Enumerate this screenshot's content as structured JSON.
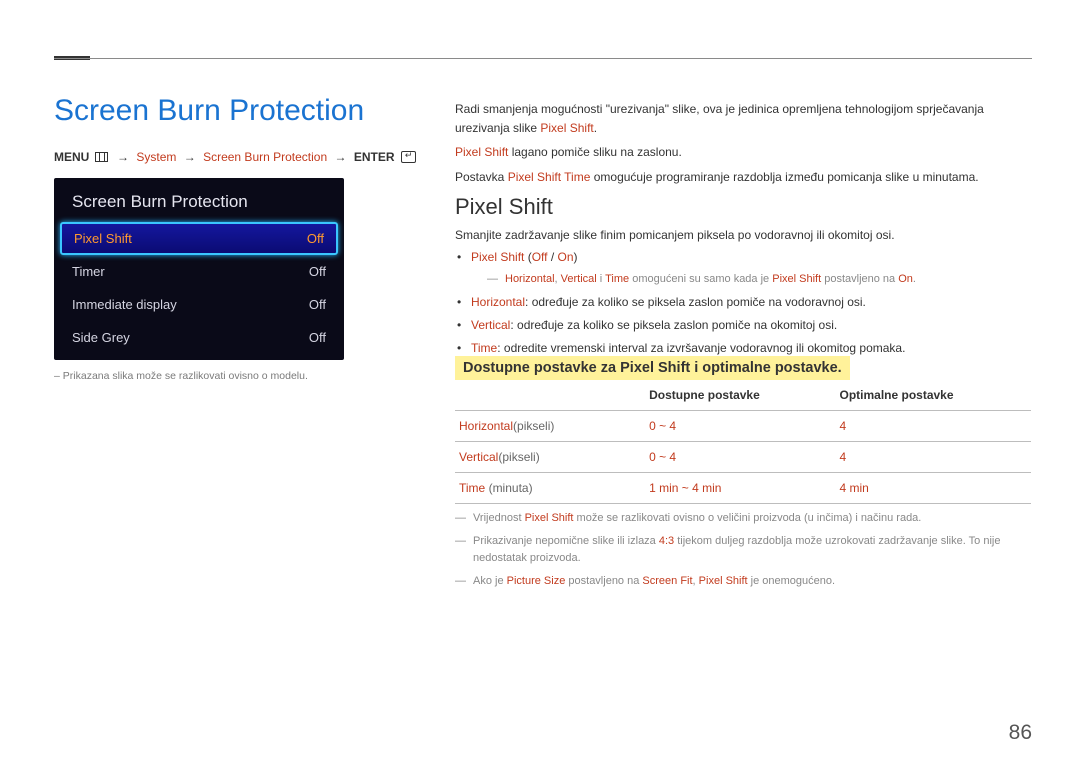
{
  "page_number": "86",
  "title": "Screen Burn Protection",
  "breadcrumb": {
    "menu": "MENU",
    "seg1": "System",
    "seg2": "Screen Burn Protection",
    "enter": "ENTER"
  },
  "panel": {
    "title": "Screen Burn Protection",
    "rows": [
      {
        "label": "Pixel Shift",
        "value": "Off",
        "selected": true
      },
      {
        "label": "Timer",
        "value": "Off",
        "selected": false
      },
      {
        "label": "Immediate display",
        "value": "Off",
        "selected": false
      },
      {
        "label": "Side Grey",
        "value": "Off",
        "selected": false
      }
    ],
    "footnote": "Prikazana slika može se razlikovati ovisno o modelu."
  },
  "intro": {
    "p1_pre": "Radi smanjenja mogućnosti \"urezivanja\" slike, ova je jedinica opremljena tehnologijom sprječavanja urezivanja slike ",
    "p1_red": "Pixel Shift",
    "p1_post": ".",
    "p2_red": "Pixel Shift",
    "p2_post": " lagano pomiče sliku na zaslonu.",
    "p3_pre": "Postavka ",
    "p3_red": "Pixel Shift Time",
    "p3_post": " omogućuje programiranje razdoblja između pomicanja slike u minutama."
  },
  "section": {
    "heading": "Pixel Shift",
    "desc": "Smanjite zadržavanje slike finim pomicanjem piksela po vodoravnoj ili okomitoj osi.",
    "bullet1_red": "Pixel Shift",
    "bullet1_mid": " (",
    "bullet1_off": "Off",
    "bullet1_sep": " / ",
    "bullet1_on": "On",
    "bullet1_end": ")",
    "note1": {
      "r1": "Horizontal",
      "c1": ", ",
      "r2": "Vertical",
      "c2": " i ",
      "r3": "Time",
      "mid": " omogućeni su samo kada je ",
      "r4": "Pixel Shift",
      "mid2": " postavljeno na ",
      "r5": "On",
      "end": "."
    },
    "bullet2_red": "Horizontal",
    "bullet2_text": ": određuje za koliko se piksela zaslon pomiče na vodoravnoj osi.",
    "bullet3_red": "Vertical",
    "bullet3_text": ": određuje za koliko se piksela zaslon pomiče na okomitoj osi.",
    "bullet4_red": "Time",
    "bullet4_text": ": odredite vremenski interval za izvršavanje vodoravnog ili okomitog pomaka."
  },
  "hl_heading": "Dostupne postavke za Pixel Shift i optimalne postavke.",
  "table": {
    "col_available": "Dostupne postavke",
    "col_optimal": "Optimalne postavke",
    "rows": [
      {
        "label_red": "Horizontal",
        "unit": "(pikseli)",
        "available": "0 ~ 4",
        "optimal": "4"
      },
      {
        "label_red": "Vertical",
        "unit": "(pikseli)",
        "available": "0 ~ 4",
        "optimal": "4"
      },
      {
        "label_red": "Time",
        "unit": " (minuta)",
        "available": "1 min ~ 4 min",
        "optimal": "4 min"
      }
    ]
  },
  "notes": {
    "n1_pre": "Vrijednost ",
    "n1_red": "Pixel Shift",
    "n1_post": " može se razlikovati ovisno o veličini proizvoda (u inčima) i načinu rada.",
    "n2_pre": "Prikazivanje nepomične slike ili izlaza ",
    "n2_red": "4:3",
    "n2_post": " tijekom duljeg razdoblja može uzrokovati zadržavanje slike. To nije nedostatak proizvoda.",
    "n3_pre": "Ako je ",
    "n3_red1": "Picture Size",
    "n3_mid1": " postavljeno na ",
    "n3_red2": "Screen Fit",
    "n3_mid2": ", ",
    "n3_red3": "Pixel Shift",
    "n3_post": " je onemogućeno."
  }
}
